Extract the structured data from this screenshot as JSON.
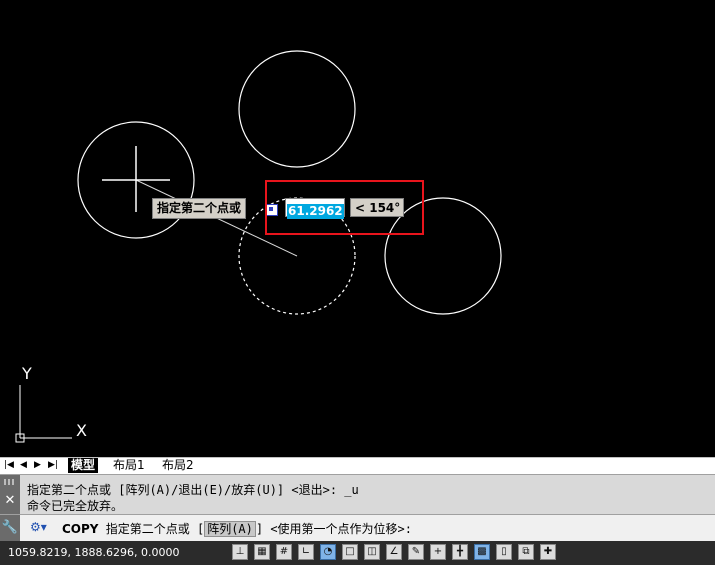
{
  "canvas": {
    "tooltip_label": "指定第二个点或",
    "distance_value": "61.2962",
    "angle_value": "< 154°",
    "ucs_y_label": "Y",
    "ucs_x_label": "X"
  },
  "layout_tabs": {
    "nav": [
      "|◀",
      "◀",
      "▶",
      "▶|"
    ],
    "tabs": [
      {
        "label": "模型",
        "active": true
      },
      {
        "label": "布局1",
        "active": false
      },
      {
        "label": "布局2",
        "active": false
      }
    ]
  },
  "command_history": {
    "lines": [
      "指定第二个点或 [阵列(A)/退出(E)/放弃(U)] <退出>: _u",
      "命令已完全放弃。"
    ]
  },
  "command_line": {
    "command": "COPY",
    "prompt_before": "指定第二个点或 [",
    "option": "阵列(A)",
    "prompt_after": "] <使用第一个点作为位移>:"
  },
  "status_bar": {
    "coordinates": "1059.8219,  1888.6296,  0.0000",
    "buttons": [
      {
        "name": "infer-constraints",
        "glyph": "⊥",
        "on": false
      },
      {
        "name": "snap",
        "glyph": "▦",
        "on": false
      },
      {
        "name": "grid",
        "glyph": "#",
        "on": false
      },
      {
        "name": "ortho",
        "glyph": "∟",
        "on": false
      },
      {
        "name": "polar",
        "glyph": "◔",
        "on": true
      },
      {
        "name": "osnap",
        "glyph": "□",
        "on": false
      },
      {
        "name": "3d-osnap",
        "glyph": "◫",
        "on": false
      },
      {
        "name": "otrack",
        "glyph": "∠",
        "on": false
      },
      {
        "name": "ducs",
        "glyph": "✎",
        "on": false
      },
      {
        "name": "dyn",
        "glyph": "+",
        "on": false
      },
      {
        "name": "lineweight",
        "glyph": "╋",
        "on": false
      },
      {
        "name": "transparency",
        "glyph": "▩",
        "on": true
      },
      {
        "name": "quick-properties",
        "glyph": "▯",
        "on": false
      },
      {
        "name": "selection-cycling",
        "glyph": "⧉",
        "on": false
      },
      {
        "name": "annotation-monitor",
        "glyph": "✚",
        "on": false
      }
    ]
  },
  "colors": {
    "canvas_bg": "#000000",
    "highlight": "#e8141c",
    "input_highlight": "#00a8e0"
  }
}
